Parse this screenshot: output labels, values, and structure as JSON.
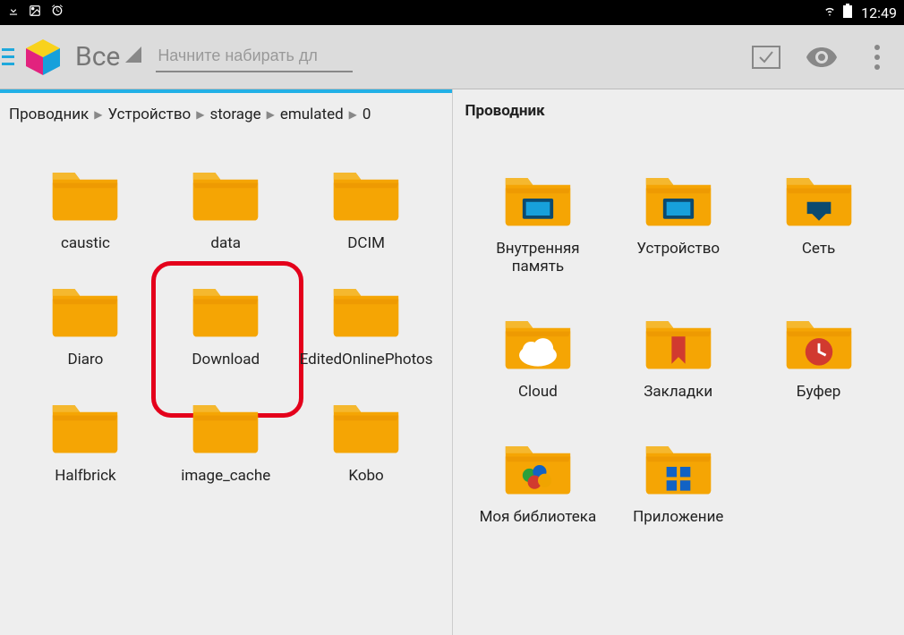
{
  "status": {
    "time": "12:49"
  },
  "toolbar": {
    "filter_label": "Все",
    "search_placeholder": "Начните набирать дл"
  },
  "left": {
    "breadcrumb": [
      "Проводник",
      "Устройство",
      "storage",
      "emulated",
      "0"
    ],
    "folders": [
      {
        "name": "caustic"
      },
      {
        "name": "data"
      },
      {
        "name": "DCIM"
      },
      {
        "name": "Diaro"
      },
      {
        "name": "Download",
        "highlighted": true
      },
      {
        "name": "EditedOnlinePhotos"
      },
      {
        "name": "Halfbrick"
      },
      {
        "name": "image_cache"
      },
      {
        "name": "Kobo"
      }
    ]
  },
  "right": {
    "title": "Проводник",
    "items": [
      {
        "name": "Внутренняя память",
        "overlay": "sdcard"
      },
      {
        "name": "Устройство",
        "overlay": "device"
      },
      {
        "name": "Сеть",
        "overlay": "network"
      },
      {
        "name": "Cloud",
        "overlay": "cloud"
      },
      {
        "name": "Закладки",
        "overlay": "bookmark"
      },
      {
        "name": "Буфер",
        "overlay": "clock"
      },
      {
        "name": "Моя библиотека",
        "overlay": "library"
      },
      {
        "name": "Приложение",
        "overlay": "apps"
      }
    ]
  }
}
